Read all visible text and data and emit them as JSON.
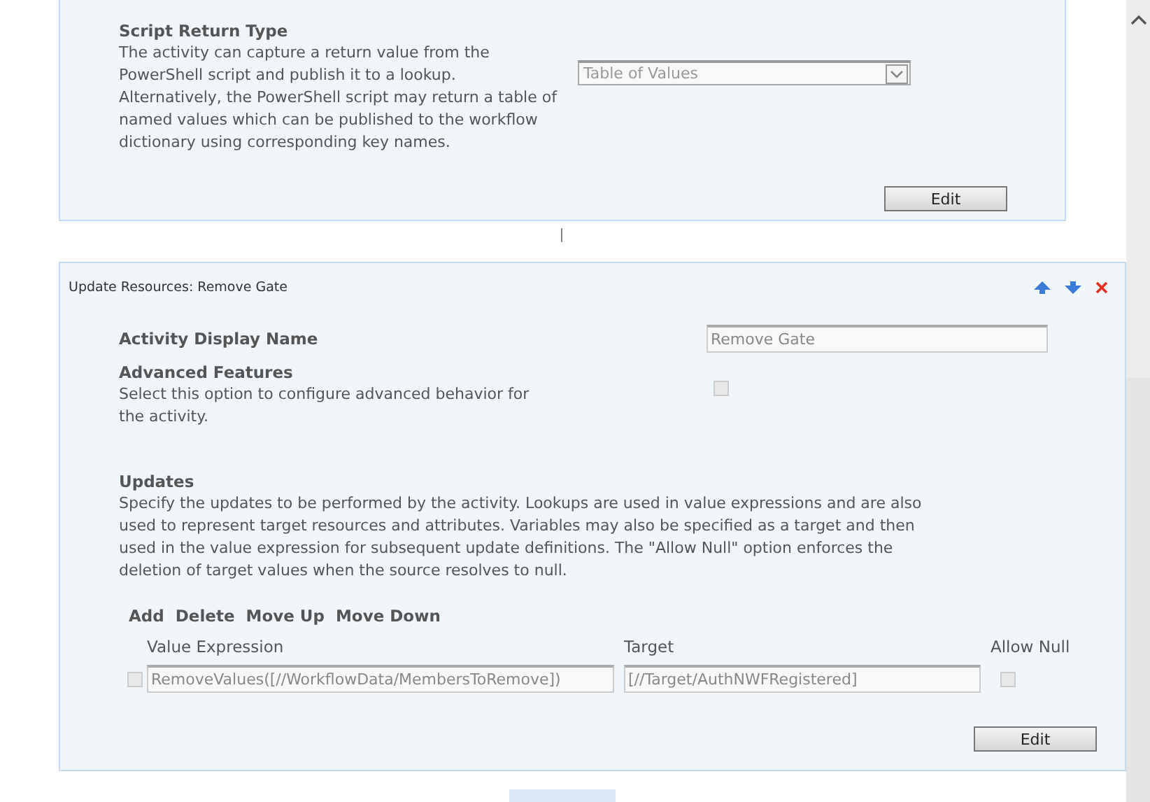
{
  "script_return_panel": {
    "heading": "Script Return Type",
    "description": "The activity can capture a return value from the PowerShell script and publish it to a lookup. Alternatively, the PowerShell script may return a table of named values which can be published to the workflow dictionary using corresponding key names.",
    "dropdown": {
      "value": "Table of Values",
      "disabled": true
    },
    "edit_button": "Edit"
  },
  "activity_panel": {
    "title": "Update Resources: Remove Gate",
    "display_name": {
      "label": "Activity Display Name",
      "value": "Remove Gate",
      "disabled": true
    },
    "advanced": {
      "label": "Advanced Features",
      "description": "Select this option to configure advanced behavior for the activity.",
      "checked": false
    },
    "updates": {
      "label": "Updates",
      "description": "Specify the updates to be performed by the activity. Lookups are used in value expressions and are also used to represent target resources and attributes. Variables may also be specified as a target and then used in the value expression for subsequent update definitions. The \"Allow Null\" option enforces the deletion of target values when the source resolves to null."
    },
    "actions": [
      "Add",
      "Delete",
      "Move Up",
      "Move Down"
    ],
    "columns": [
      "Value Expression",
      "Target",
      "Allow Null"
    ],
    "rows": [
      {
        "selected": false,
        "value_expression": "RemoveValues([//WorkflowData/MembersToRemove])",
        "target": "[//Target/AuthNWFRegistered]",
        "allow_null": false
      }
    ],
    "edit_button": "Edit"
  }
}
